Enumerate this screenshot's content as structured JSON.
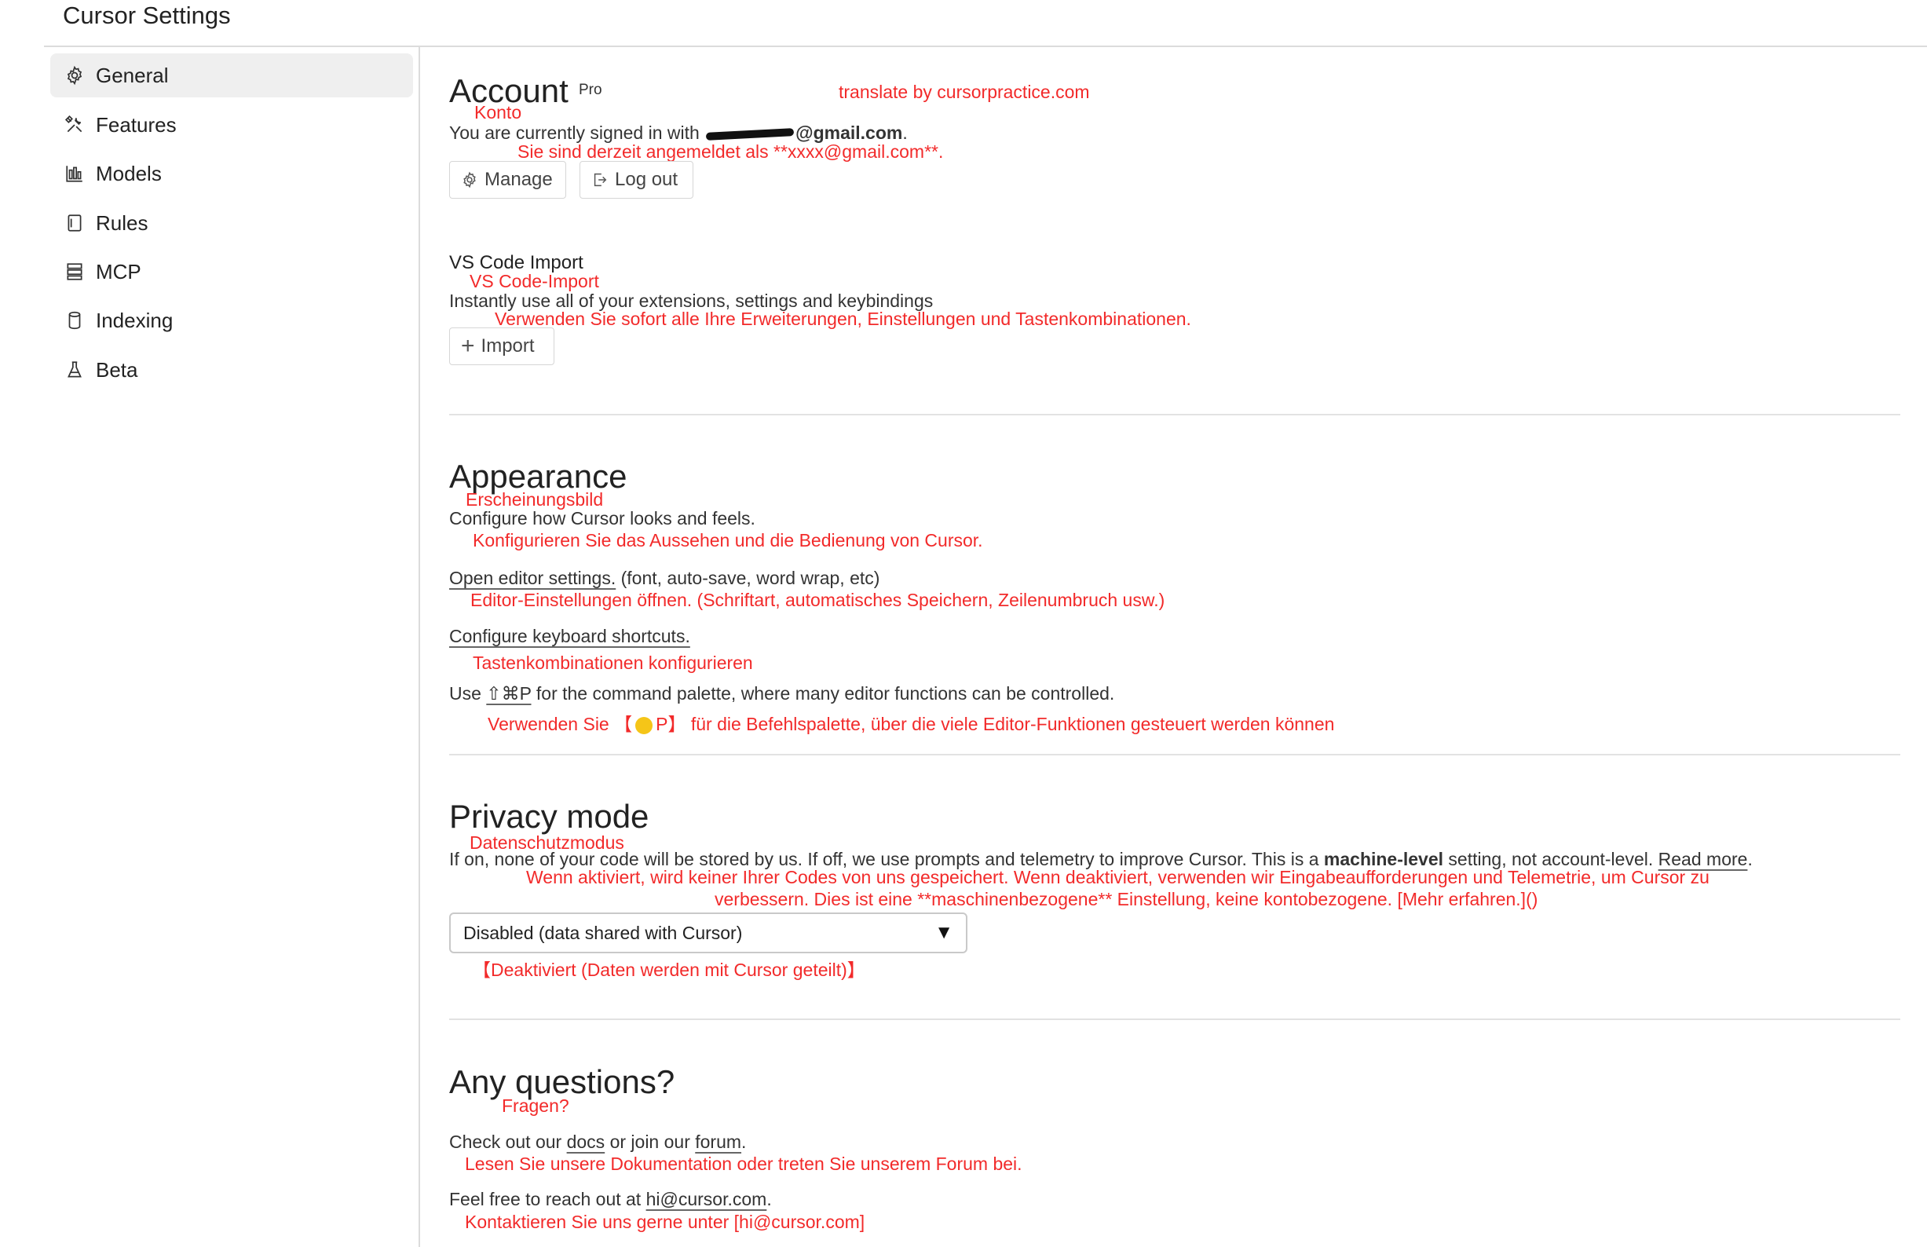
{
  "window": {
    "title": "Cursor Settings"
  },
  "sidebar": {
    "items": [
      {
        "label": "General",
        "icon": "gear-icon",
        "active": true
      },
      {
        "label": "Features",
        "icon": "tools-icon"
      },
      {
        "label": "Models",
        "icon": "bar-chart-icon"
      },
      {
        "label": "Rules",
        "icon": "document-icon"
      },
      {
        "label": "MCP",
        "icon": "server-icon"
      },
      {
        "label": "Indexing",
        "icon": "database-icon"
      },
      {
        "label": "Beta",
        "icon": "flask-icon"
      }
    ]
  },
  "account": {
    "title": "Account",
    "plan_badge": "Pro",
    "title_de": "Konto",
    "translate_credit": "translate by cursorpractice.com",
    "signed_in_prefix": "You are currently signed in with ",
    "email_suffix": "@gmail.com",
    "signed_in_period": ".",
    "signed_in_de": "Sie sind derzeit angemeldet als **xxxx@gmail.com**.",
    "manage_label": "Manage",
    "logout_label": "Log out"
  },
  "vscode_import": {
    "title": "VS Code Import",
    "title_de": "VS Code-Import",
    "description": "Instantly use all of your extensions, settings and keybindings",
    "description_de": "Verwenden Sie sofort alle Ihre Erweiterungen, Einstellungen und Tastenkombinationen.",
    "import_label": "Import"
  },
  "appearance": {
    "title": "Appearance",
    "title_de": "Erscheinungsbild",
    "description": "Configure how Cursor looks and feels.",
    "description_de": "Konfigurieren Sie das Aussehen und die Bedienung von Cursor.",
    "editor_link": "Open editor settings.",
    "editor_hint": " (font, auto-save, word wrap, etc)",
    "editor_de": "Editor-Einstellungen öffnen. (Schriftart, automatisches Speichern, Zeilenumbruch usw.)",
    "shortcuts_link": "Configure keyboard shortcuts.",
    "shortcuts_de": "Tastenkombinationen konfigurieren",
    "palette_prefix": "Use ",
    "palette_keys": "⇧⌘P",
    "palette_suffix": " for the command palette, where many editor functions can be controlled.",
    "palette_de_prefix": "Verwenden Sie 【",
    "palette_de_key": "P】",
    "palette_de_suffix": " für die Befehlspalette, über die viele Editor-Funktionen gesteuert werden können"
  },
  "privacy": {
    "title": "Privacy mode",
    "title_de": "Datenschutzmodus",
    "description_prefix": "If on, none of your code will be stored by us. If off, we use prompts and telemetry to improve Cursor. This is a ",
    "description_bold": "machine-level",
    "description_suffix": " setting, not account-level. ",
    "read_more": "Read more",
    "description_end": ".",
    "description_de_line1": "Wenn aktiviert, wird keiner Ihrer Codes von uns gespeichert. Wenn deaktiviert, verwenden wir Eingabeaufforderungen und Telemetrie, um Cursor zu",
    "description_de_line2": "verbessern. Dies ist eine **maschinenbezogene** Einstellung, keine kontobezogene. [Mehr erfahren.]()",
    "select_value": "Disabled (data shared with Cursor)",
    "select_caret": "▼",
    "select_de": "【Deaktiviert (Daten werden mit Cursor geteilt)】"
  },
  "questions": {
    "title": "Any questions?",
    "title_de": "Fragen?",
    "check_prefix": "Check out our ",
    "docs_link": "docs",
    "check_middle": " or join our ",
    "forum_link": "forum",
    "check_end": ".",
    "check_de": "Lesen Sie unsere Dokumentation oder treten Sie unserem Forum bei.",
    "reach_prefix": "Feel free to reach out at ",
    "email_link": "hi@cursor.com",
    "reach_end": ".",
    "reach_de": "Kontaktieren Sie uns gerne unter [hi@cursor.com]"
  }
}
